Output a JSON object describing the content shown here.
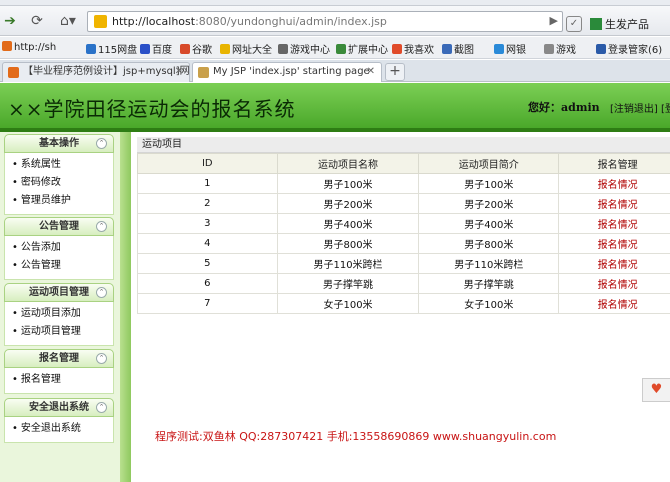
{
  "browser": {
    "address_host": "http://localhost",
    "address_rest": ":8080/yundonghui/admin/index.jsp",
    "product_label": "生发产品",
    "favorites": [
      "http://sh",
      "115网盘",
      "百度",
      "谷歌",
      "网址大全",
      "游戏中心",
      "扩展中心",
      "我喜欢",
      "截图",
      "网银",
      "游戏",
      "登录管家(6)"
    ],
    "tabs": [
      {
        "label": "【毕业程序范例设计】jsp+mysql]网..."
      },
      {
        "label": "My JSP 'index.jsp' starting page"
      }
    ],
    "new_tab": "+"
  },
  "header": {
    "title": "××学院田径运动会的报名系统",
    "greeting": "您好：admin",
    "logout": "[注销退出] [登"
  },
  "sidebar": {
    "groups": [
      {
        "title": "基本操作",
        "items": [
          "系统属性",
          "密码修改",
          "管理员维护"
        ]
      },
      {
        "title": "公告管理",
        "items": [
          "公告添加",
          "公告管理"
        ]
      },
      {
        "title": "运动项目管理",
        "items": [
          "运动项目添加",
          "运动项目管理"
        ]
      },
      {
        "title": "报名管理",
        "items": [
          "报名管理"
        ]
      },
      {
        "title": "安全退出系统",
        "items": [
          "安全退出系统"
        ]
      }
    ]
  },
  "main": {
    "panel_title": "运动项目",
    "columns": [
      "ID",
      "运动项目名称",
      "运动项目简介",
      "报名管理"
    ],
    "rows": [
      {
        "id": "1",
        "name": "男子100米",
        "intro": "男子100米",
        "action": "报名情况"
      },
      {
        "id": "2",
        "name": "男子200米",
        "intro": "男子200米",
        "action": "报名情况"
      },
      {
        "id": "3",
        "name": "男子400米",
        "intro": "男子400米",
        "action": "报名情况"
      },
      {
        "id": "4",
        "name": "男子800米",
        "intro": "男子800米",
        "action": "报名情况"
      },
      {
        "id": "5",
        "name": "男子110米跨栏",
        "intro": "男子110米跨栏",
        "action": "报名情况"
      },
      {
        "id": "6",
        "name": "男子撑竿跳",
        "intro": "男子撑竿跳",
        "action": "报名情况"
      },
      {
        "id": "7",
        "name": "女子100米",
        "intro": "女子100米",
        "action": "报名情况"
      }
    ]
  },
  "footer": {
    "text": "程序测试:双鱼林 QQ:287307421 手机:13558690869 www.shuangyulin.com"
  },
  "colors": {
    "header_green": "#4aa82a",
    "link_red": "#b00000",
    "footer_red": "#c81414"
  }
}
